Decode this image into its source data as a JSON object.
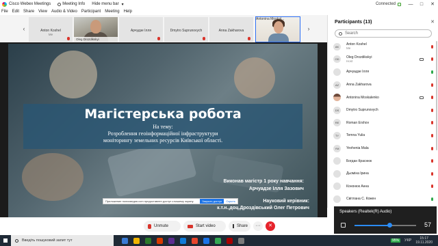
{
  "window": {
    "title": "Cisco Webex Meetings",
    "meeting_info": "Meeting Info",
    "hide_menu_bar": "Hide menu bar",
    "connection": "Connected",
    "controls": [
      "—",
      "□",
      "✕"
    ]
  },
  "menu": [
    "File",
    "Edit",
    "Share",
    "View",
    "Audio & Video",
    "Participant",
    "Meeting",
    "Help"
  ],
  "strip": {
    "tiles": [
      {
        "name": "Anton Koshel",
        "sub": "Me",
        "kind": "avatar"
      },
      {
        "name": "Oleg Drozdikskyi",
        "sub": "(Host)",
        "kind": "video"
      },
      {
        "name": "Арчудзе Ілля",
        "sub": "",
        "kind": "avatar"
      },
      {
        "name": "Dmytro Suprunovych",
        "sub": "",
        "kind": "avatar"
      },
      {
        "name": "Anna Zakharova",
        "sub": "",
        "kind": "avatar"
      },
      {
        "name": "Antonina Moskal...",
        "sub": "",
        "kind": "video2"
      }
    ],
    "prev": "‹",
    "next": "›"
  },
  "slide": {
    "title": "Магістерська робота",
    "topic": "На тему:",
    "desc_line1": "Розроблення геоінформаційної інфраструктури",
    "desc_line2": "моніторингу земельних ресурсів Київської області.",
    "author_label": "Виконав магістр 1 року навчання:",
    "author_name": "Арчуадзе Ілля Зазович",
    "supervisor_label": "Науковий керівник:",
    "supervisor_name": "к.т.н.,доц.Дроздівський Олег Петрович"
  },
  "share_banner": {
    "text": "Приложение полисмедия.com предоставлен доступ к вашему экрану.",
    "stop": "Закрыть доступ",
    "hide": "Скрыть"
  },
  "controls": {
    "unmute": "Unmute",
    "start_video": "Start video",
    "share": "Share",
    "more": "···",
    "end": "✕"
  },
  "panel": {
    "title": "Participants (13)",
    "close": "✕",
    "search_placeholder": "Search",
    "participants": [
      {
        "initials": "AK",
        "name": "Anton Koshel",
        "role": "Me",
        "mic": "muted",
        "cam": false,
        "photo": false
      },
      {
        "initials": "OD",
        "name": "Oleg Drozdikskyi",
        "role": "Host",
        "mic": "muted",
        "cam": true,
        "photo": false
      },
      {
        "initials": "",
        "name": "Арчуадзе Ілля",
        "role": "",
        "mic": "on",
        "cam": false,
        "photo": false
      },
      {
        "initials": "AZ",
        "name": "Anna Zakharova",
        "role": "",
        "mic": "muted",
        "cam": false,
        "photo": false
      },
      {
        "initials": "",
        "name": "Antonina Moskalenko",
        "role": "",
        "mic": "muted",
        "cam": true,
        "photo": true
      },
      {
        "initials": "DS",
        "name": "Dmytro Suprunovych",
        "role": "",
        "mic": "muted",
        "cam": false,
        "photo": false
      },
      {
        "initials": "RE",
        "name": "Roman Ershov",
        "role": "",
        "mic": "muted",
        "cam": false,
        "photo": false
      },
      {
        "initials": "TY",
        "name": "Temna Yulia",
        "role": "",
        "mic": "muted",
        "cam": false,
        "photo": false
      },
      {
        "initials": "YM",
        "name": "Yevhenia Mala",
        "role": "",
        "mic": "muted",
        "cam": false,
        "photo": false
      },
      {
        "initials": "",
        "name": "Богдан Краснюк",
        "role": "",
        "mic": "muted",
        "cam": false,
        "photo": false
      },
      {
        "initials": "",
        "name": "Дьоміна Ірина",
        "role": "",
        "mic": "muted",
        "cam": false,
        "photo": false
      },
      {
        "initials": "",
        "name": "Кононюк Анна",
        "role": "",
        "mic": "muted",
        "cam": false,
        "photo": false
      },
      {
        "initials": "",
        "name": "Світлана С. Кожен",
        "role": "",
        "mic": "on",
        "cam": false,
        "photo": false
      }
    ]
  },
  "audio": {
    "device": "Speakers (Realtek(R) Audio)",
    "volume": 57,
    "volume_text": "57"
  },
  "taskbar": {
    "search": "Введіть пошуковий запит тут",
    "battery": "95%",
    "lang": "УКР",
    "time": "15:17",
    "date": "19.11.2020",
    "app_colors": [
      "#3a7bd5",
      "#f0b400",
      "#2b7a2b",
      "#d83b01",
      "#5c2d91",
      "#0f7bd8",
      "#e8452c",
      "#1a73e8",
      "#33a852",
      "#a80000",
      "#7a7a7a"
    ]
  },
  "colors": {
    "accent": "#2b6ef5",
    "muted_mic": "#d9342b",
    "active_mic": "#2ea84a",
    "end_button": "#e6242c",
    "slide_band": "#295673"
  }
}
